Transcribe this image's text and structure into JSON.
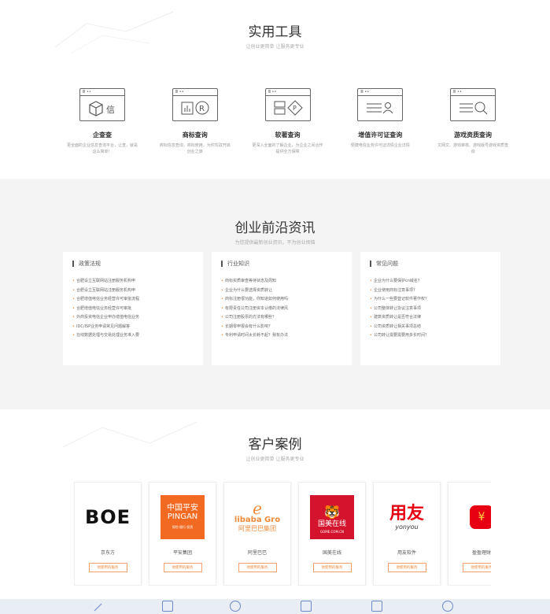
{
  "tools": {
    "title": "实用工具",
    "subtitle": "让创业更简单 让服务更专业",
    "items": [
      {
        "name": "企查查",
        "desc": "更全面的企业信息查询平台，让查，就是这么简单！",
        "icon": "box-icon",
        "tag": "信"
      },
      {
        "name": "商标查询",
        "desc": "商标信息查询，商标使用，为你驾驭开启创业之旅",
        "icon": "trademark-icon",
        "tag": "R"
      },
      {
        "name": "软著查询",
        "desc": "更深入全面的了解企业，为企业之间合作提供全方保障",
        "icon": "copyright-icon",
        "tag": "P"
      },
      {
        "name": "增值许可证查询",
        "desc": "便捷电信业务许可证详情企业详情",
        "icon": "license-icon",
        "tag": ""
      },
      {
        "name": "游戏资质查询",
        "desc": "文网文、游戏审核、游戏版号游戏资质查询",
        "icon": "game-search-icon",
        "tag": ""
      }
    ]
  },
  "news": {
    "title": "创业前沿资讯",
    "subtitle": "为您提供最新创业资讯，不为创业烦恼",
    "columns": [
      {
        "title": "政策法规",
        "items": [
          "合肥设立互联网站注册服务机构申",
          "合肥设立互联网站注册服务机构申",
          "合肥增值电信业务经营许可审批流程",
          "合肥增值电信业务经营许可审批",
          "外商投资电信企业申办增值电信业务",
          "IDC/ISP业务申请常见问题解答",
          "在线数据处理与交易处理业务准入要"
        ]
      },
      {
        "title": "行业知识",
        "items": [
          "商标实质审查等待状态及周知",
          "企业为什么要选择资质转让",
          "商标注册很功能，你知道如何使用吗",
          "有限责任公司注册资本认缴的法律风",
          "公司注册股票的方法有哪些？",
          "长期零申报会有什么影响？",
          "专利申请时间太长耗不起？我有办法"
        ]
      },
      {
        "title": "常见问题",
        "items": [
          "企业为什么要保护cn域名？",
          "企业使用商标注意事项？",
          "为什么一些要登记软件著作权？",
          "公司整体转让协议注意事项",
          "建筑资质转让是否符合法律",
          "公司资质转让相关事项总结",
          "公司转让需要需要用多长时间？"
        ]
      }
    ]
  },
  "cases": {
    "title": "客户案例",
    "subtitle": "让创业更简单 让服务更专业",
    "button_label": "他使用的服务",
    "items": [
      {
        "name": "京东方",
        "logo_text": "BOE",
        "logo_sub": ""
      },
      {
        "name": "平安集团",
        "logo_text": "中国平安",
        "logo_sub": "PINGAN",
        "logo_tag": "保险·银行·投资"
      },
      {
        "name": "阿里巴巴",
        "logo_text": "libaba Gro",
        "logo_sub": "阿里巴巴集团"
      },
      {
        "name": "国美在线",
        "logo_text": "国美在线",
        "logo_sub": "GOME.COM.CN"
      },
      {
        "name": "用友软件",
        "logo_text": "用友",
        "logo_sub": "yonyou"
      },
      {
        "name": "盈盈理财",
        "logo_text": "¥",
        "logo_sub": ""
      }
    ]
  },
  "colors": {
    "accent": "#f08a3a",
    "pingan": "#f26a21",
    "gome": "#d3142c",
    "yonyou": "#e60012",
    "footer": "#e9eef4"
  }
}
